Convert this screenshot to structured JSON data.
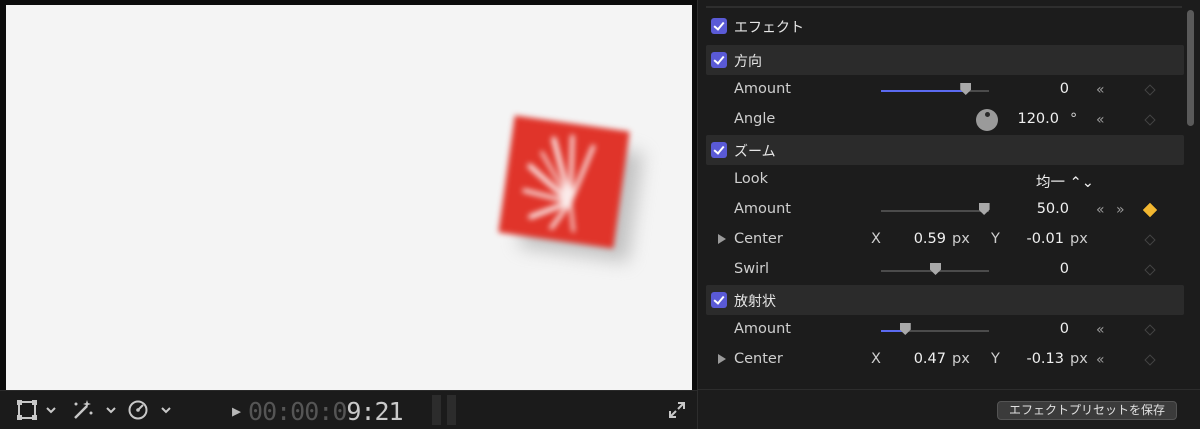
{
  "viewer": {
    "timecode_dim": "00:00:0",
    "timecode_bright": "9:21",
    "icons": [
      "transform-icon",
      "enhance-wand-icon",
      "speed-icon",
      "fullscreen-icon"
    ]
  },
  "inspector": {
    "effect_section": {
      "title": "エフェクト",
      "checked": true
    },
    "groups": [
      {
        "title": "方向",
        "checked": true,
        "params": [
          {
            "label": "Amount",
            "value": "0",
            "slider": 0.78
          },
          {
            "label": "Angle",
            "value": "120.0",
            "unit": "°"
          }
        ]
      },
      {
        "title": "ズーム",
        "checked": true,
        "params": [
          {
            "label": "Look",
            "value": "均一 ⌃⌄"
          },
          {
            "label": "Amount",
            "value": "50.0",
            "slider": 0.95,
            "keyframe_active": true
          },
          {
            "label": "Center",
            "x_label": "X",
            "x": "0.59",
            "x_unit": "px",
            "y_label": "Y",
            "y": "-0.01",
            "y_unit": "px"
          },
          {
            "label": "Swirl",
            "value": "0",
            "slider": 0.5
          }
        ]
      },
      {
        "title": "放射状",
        "checked": true,
        "params": [
          {
            "label": "Amount",
            "value": "0",
            "slider": 0.22
          },
          {
            "label": "Center",
            "x_label": "X",
            "x": "0.47",
            "x_unit": "px",
            "y_label": "Y",
            "y": "-0.13",
            "y_unit": "px"
          }
        ]
      }
    ],
    "save_preset_label": "エフェクトプリセットを保存",
    "colors": {
      "accent": "#5b6af0",
      "checkbox": "#5a5ad6",
      "keyframe": "#f2b731",
      "clip": "#e0342a"
    }
  }
}
